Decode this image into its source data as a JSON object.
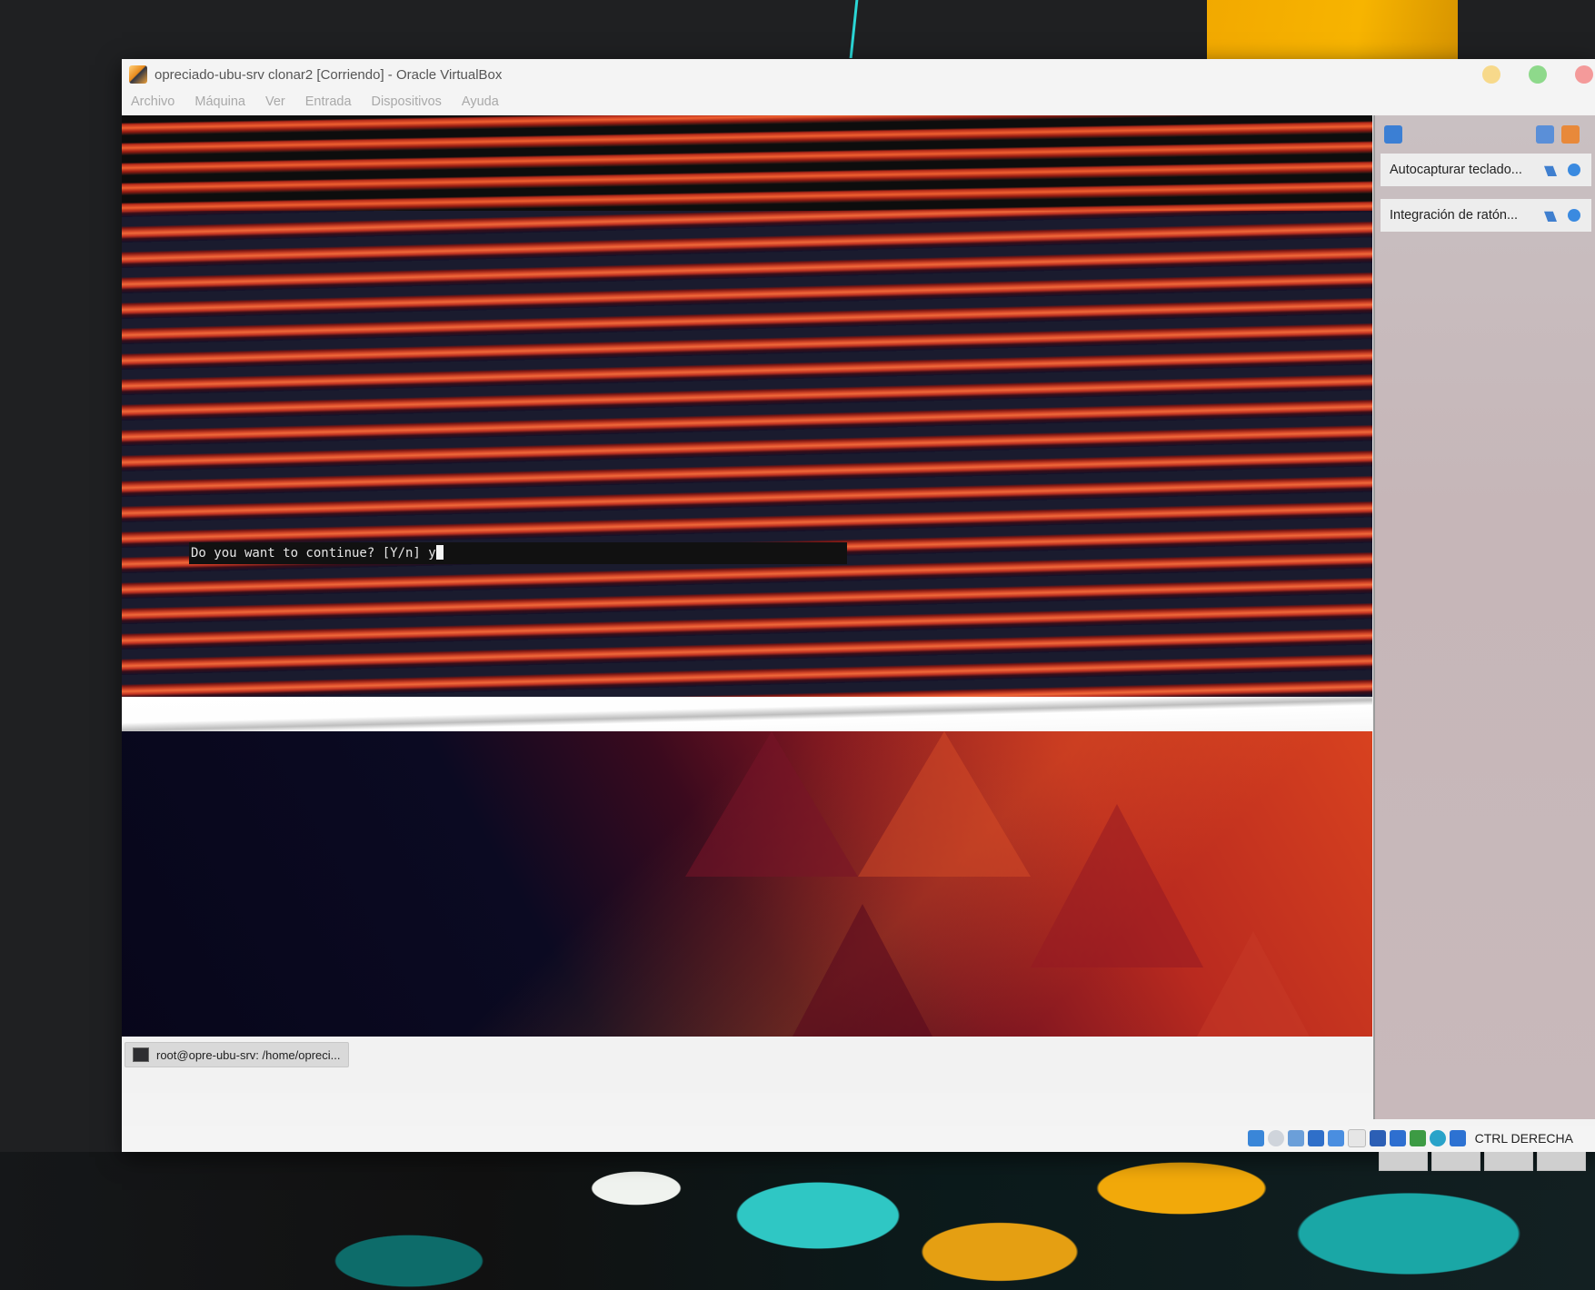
{
  "window": {
    "title": "opreciado-ubu-srv clonar2 [Corriendo] - Oracle VirtualBox"
  },
  "menu": [
    {
      "label": "Archivo"
    },
    {
      "label": "Máquina"
    },
    {
      "label": "Ver"
    },
    {
      "label": "Entrada"
    },
    {
      "label": "Dispositivos"
    },
    {
      "label": "Ayuda"
    }
  ],
  "vm": {
    "terminal_prompt": "Do you want to continue? [Y/n] y"
  },
  "taskbar": {
    "task_label": "root@opre-ubu-srv: /home/opreci..."
  },
  "notifications": [
    {
      "label": "Autocapturar teclado..."
    },
    {
      "label": "Integración de ratón..."
    }
  ],
  "statusbar": {
    "host_key": "CTRL DERECHA",
    "icons": [
      "hard-disk-icon",
      "optical-drive-icon",
      "audio-icon",
      "network-icon",
      "usb-icon",
      "shared-folders-icon",
      "display-icon",
      "video-capture-icon",
      "cpu-icon",
      "mouse-integration-icon",
      "keyboard-icon"
    ]
  },
  "colors": {
    "close": "#f49a9a",
    "maximize": "#8ed98b",
    "minimize": "#f7d98b"
  }
}
